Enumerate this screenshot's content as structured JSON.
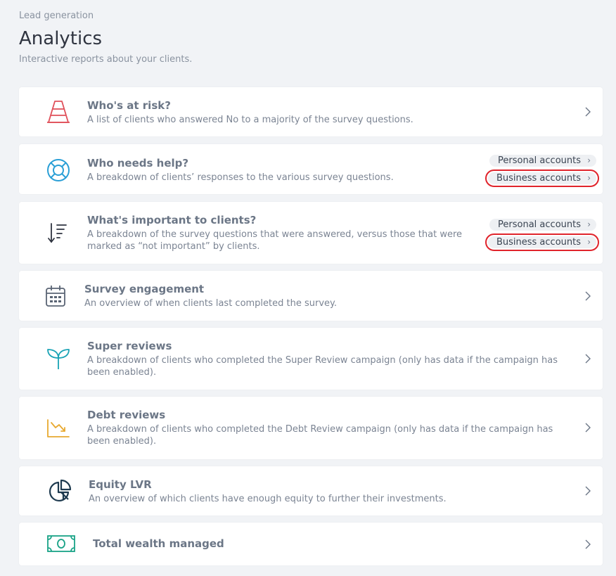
{
  "header": {
    "eyebrow": "Lead generation",
    "title": "Analytics",
    "subtitle": "Interactive reports about your clients."
  },
  "reports": [
    {
      "title": "Who's at risk?",
      "desc": "A list of clients who answered No to a majority of the survey questions.",
      "icon": "traffic-cone-icon"
    },
    {
      "title": "Who needs help?",
      "desc": "A breakdown of clients’ responses to the various survey questions.",
      "icon": "lifebuoy-icon",
      "links": {
        "personal": "Personal accounts",
        "business": "Business accounts"
      }
    },
    {
      "title": "What's important to clients?",
      "desc": "A breakdown of the survey questions that were answered, versus those that were marked as “not important” by clients.",
      "icon": "sort-descending-icon",
      "links": {
        "personal": "Personal accounts",
        "business": "Business accounts"
      }
    },
    {
      "title": "Survey engagement",
      "desc": "An overview of when clients last completed the survey.",
      "icon": "calendar-icon"
    },
    {
      "title": "Super reviews",
      "desc": "A breakdown of clients who completed the Super Review campaign (only has data if the campaign has been enabled).",
      "icon": "sprout-icon"
    },
    {
      "title": "Debt reviews",
      "desc": "A breakdown of clients who completed the Debt Review campaign (only has data if the campaign has been enabled).",
      "icon": "chart-down-icon"
    },
    {
      "title": "Equity LVR",
      "desc": "An overview of which clients have enough equity to further their investments.",
      "icon": "pie-chart-icon"
    },
    {
      "title": "Total wealth managed",
      "icon": "banknote-icon"
    }
  ],
  "colors": {
    "cone": "#e0505a",
    "lifebuoy": "#2a9fd6",
    "sprout": "#1aa3b5",
    "debt": "#e8a930",
    "pie": "#1e3a4f",
    "money": "#1aa387",
    "highlight": "#e0242c"
  }
}
